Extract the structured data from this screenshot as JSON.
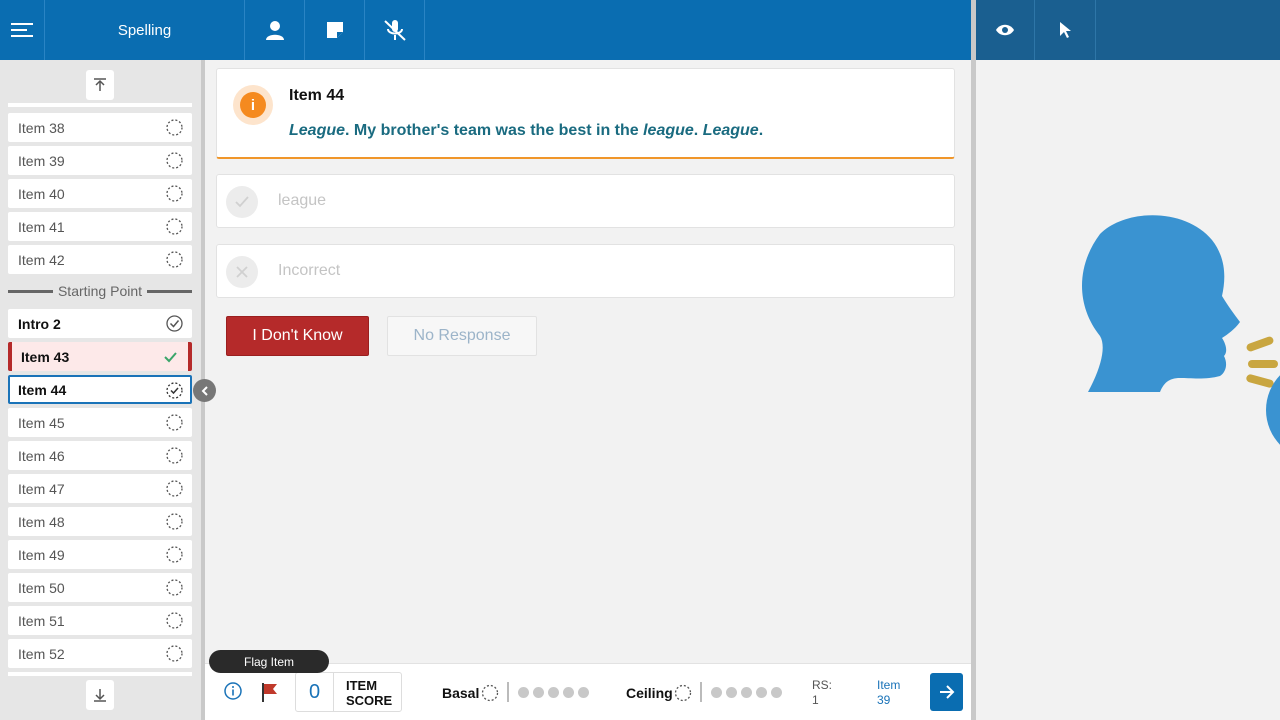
{
  "header": {
    "title": "Spelling",
    "icons": [
      "menu-icon",
      "person-icon",
      "note-icon",
      "mic-off-icon"
    ],
    "right_icons": [
      "eye-icon",
      "cursor-icon"
    ]
  },
  "sidebar": {
    "items_before": [
      {
        "label": "Item 38"
      },
      {
        "label": "Item 39"
      },
      {
        "label": "Item 40"
      },
      {
        "label": "Item 41"
      },
      {
        "label": "Item 42"
      }
    ],
    "starting_point_label": "Starting Point",
    "intro": {
      "label": "Intro 2",
      "status": "done"
    },
    "completed": {
      "label": "Item 43",
      "status": "correct"
    },
    "current": {
      "label": "Item 44",
      "status": "in-progress"
    },
    "items_after": [
      {
        "label": "Item 45"
      },
      {
        "label": "Item 46"
      },
      {
        "label": "Item 47"
      },
      {
        "label": "Item 48"
      },
      {
        "label": "Item 49"
      },
      {
        "label": "Item 50"
      },
      {
        "label": "Item 51"
      },
      {
        "label": "Item 52"
      }
    ]
  },
  "prompt": {
    "title": "Item 44",
    "word": "League",
    "sentence_pre": ". My brother's team was the best in the ",
    "word_inline": "league",
    "sentence_post": ". ",
    "word_end": "League",
    "final": "."
  },
  "responses": {
    "correct_label": "league",
    "incorrect_label": "Incorrect"
  },
  "buttons": {
    "dont_know": "I Don't Know",
    "no_response": "No Response"
  },
  "footer": {
    "tooltip": "Flag Item",
    "item_score_value": "0",
    "item_score_label_1": "ITEM",
    "item_score_label_2": "SCORE",
    "basal_label": "Basal",
    "ceiling_label": "Ceiling",
    "rs_label": "RS:",
    "rs_value": "1",
    "item_label": "Item",
    "item_value": "39"
  },
  "colors": {
    "brand": "#0a6db1",
    "danger": "#b52a2a",
    "accent": "#f58a1f",
    "head": "#3a93d1",
    "speech": "#c9a640"
  }
}
